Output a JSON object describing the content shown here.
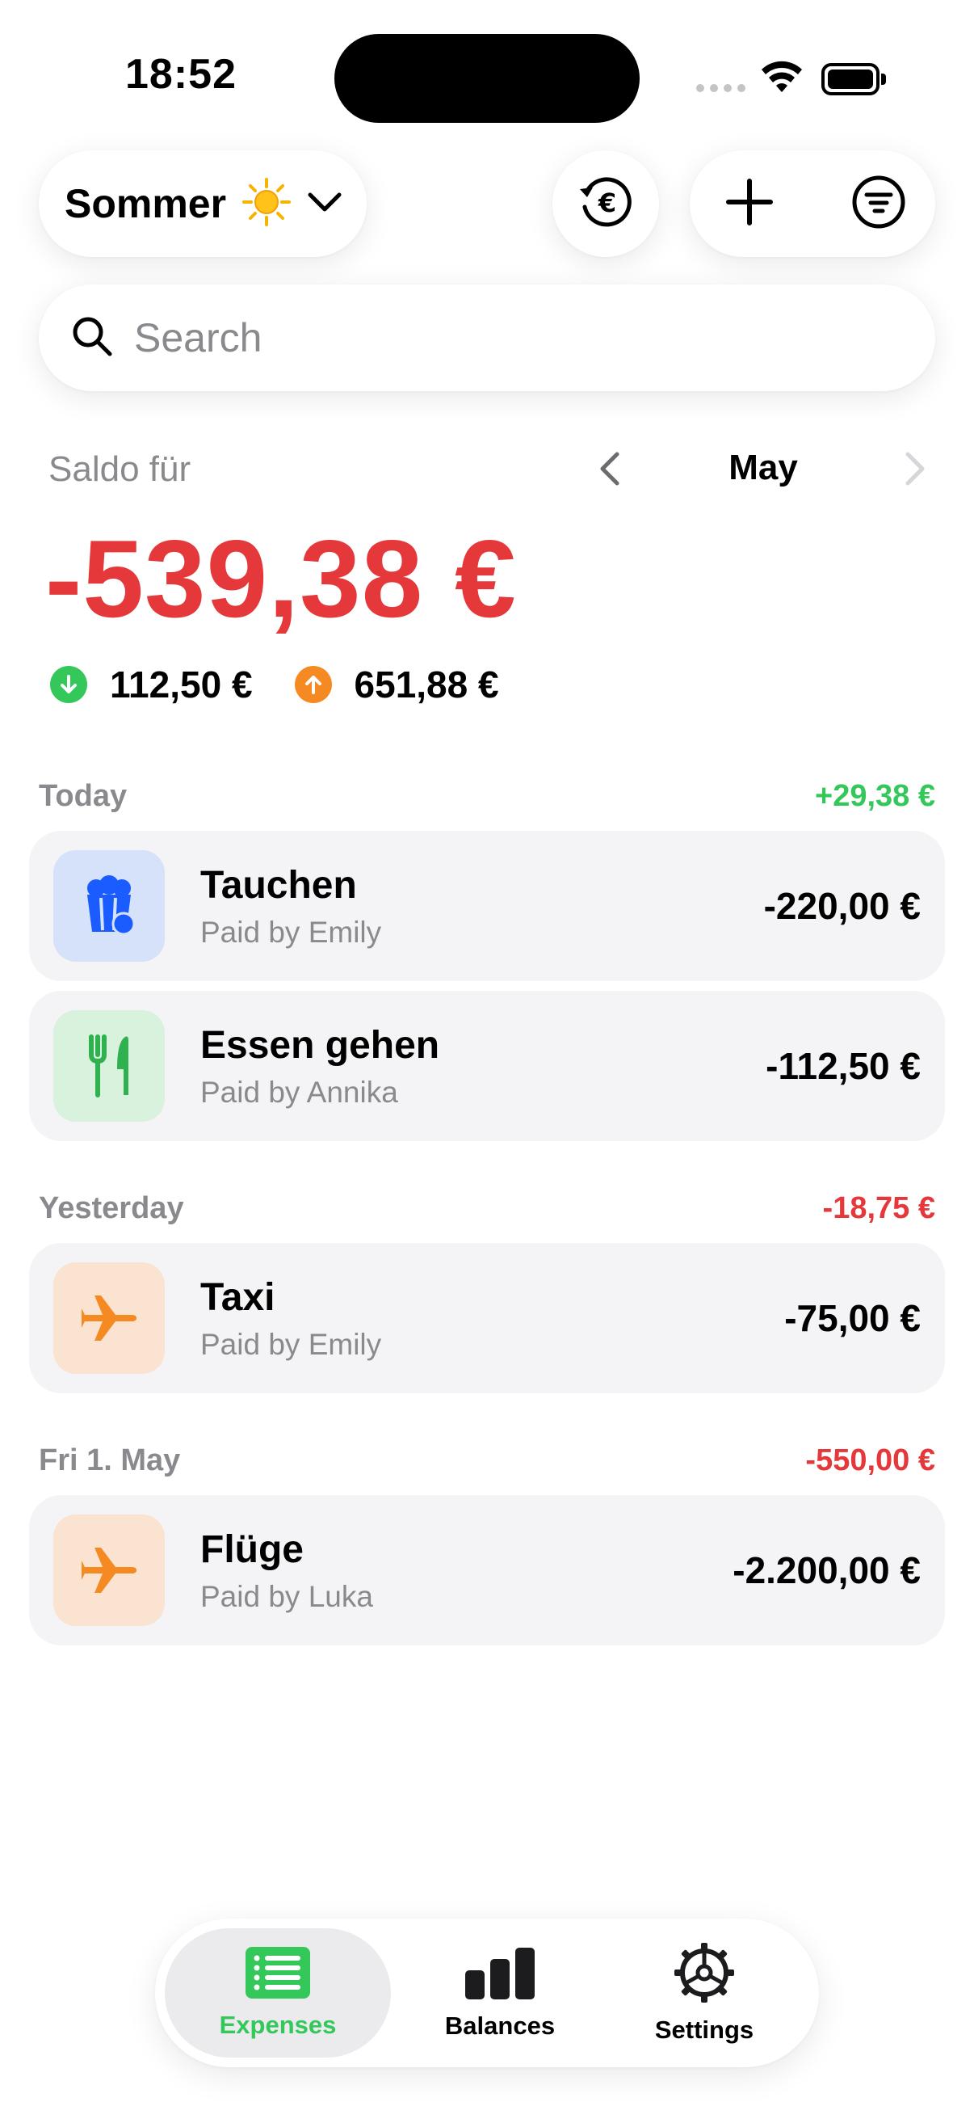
{
  "status_bar": {
    "time": "18:52"
  },
  "header": {
    "trip_name": "Sommer",
    "trip_emoji": "☀️",
    "currency_icon": "currency-euro-history-icon",
    "add_icon": "plus-icon",
    "filter_icon": "filter-icon"
  },
  "search": {
    "placeholder": "Search",
    "value": ""
  },
  "balance": {
    "label": "Saldo für",
    "month": "May",
    "total": "-539,38 €",
    "incoming": "112,50 €",
    "outgoing": "651,88 €"
  },
  "sections": [
    {
      "label": "Today",
      "total": "+29,38 €",
      "items": [
        {
          "title": "Tauchen",
          "subtitle": "Paid by Emily",
          "amount": "-220,00 €",
          "icon": "popcorn-icon"
        },
        {
          "title": "Essen gehen",
          "subtitle": "Paid by Annika",
          "amount": "-112,50 €",
          "icon": "fork-knife-icon"
        }
      ]
    },
    {
      "label": "Yesterday",
      "total": "-18,75 €",
      "items": [
        {
          "title": "Taxi",
          "subtitle": "Paid by Emily",
          "amount": "-75,00 €",
          "icon": "airplane-icon"
        }
      ]
    },
    {
      "label": "Fri 1. May",
      "total": "-550,00 €",
      "items": [
        {
          "title": "Flüge",
          "subtitle": "Paid by Luka",
          "amount": "-2.200,00 €",
          "icon": "airplane-icon"
        }
      ]
    }
  ],
  "tabs": [
    {
      "label": "Expenses",
      "icon": "list-icon",
      "selected": true
    },
    {
      "label": "Balances",
      "icon": "bar-chart-icon",
      "selected": false
    },
    {
      "label": "Settings",
      "icon": "gear-icon",
      "selected": false
    }
  ],
  "colors": {
    "negative": "#e5383b",
    "positive": "#34c759",
    "accent_green": "#34c759",
    "accent_orange": "#f58a22",
    "accent_blue": "#1a5cff",
    "card_bg": "#f4f4f6",
    "muted_text": "#8a8a8e"
  }
}
